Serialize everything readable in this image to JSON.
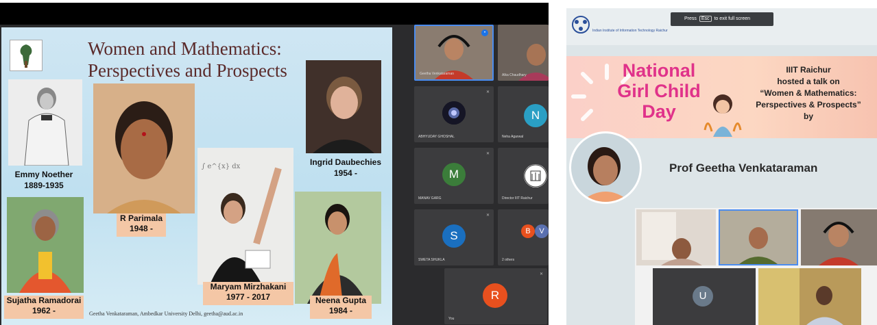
{
  "colors": {
    "slide_title": "#5a2a2a",
    "caption_bg": "#f4c7a6",
    "meeting_bg": "#2b2b2d",
    "banner_title": "#e0328a",
    "banner_bg": "#fbd4c4",
    "avatar_green": "#3b7d3a",
    "avatar_blue": "#1a6fbf",
    "avatar_orange": "#e8501e",
    "avatar_cyan": "#2a9fc4"
  },
  "slide": {
    "title_line1": "Women and Mathematics:",
    "title_line2": "Perspectives and Prospects",
    "people": [
      {
        "name": "Emmy Noether",
        "years": "1889-1935"
      },
      {
        "name": "R Parimala",
        "years": "1948 -"
      },
      {
        "name": "Ingrid Daubechies",
        "years": "1954 -"
      },
      {
        "name": "Sujatha Ramadorai",
        "years": "1962 -"
      },
      {
        "name": "Maryam Mirzhakani",
        "years": "1977 - 2017"
      },
      {
        "name": "Neena Gupta",
        "years": "1984 -"
      }
    ],
    "footer": "Geetha Venkataraman, Ambedkar University Delhi, geetha@aud.ac.in"
  },
  "meeting": {
    "tiles": [
      {
        "name": "Geetha Venkataraman",
        "icon": "video-person"
      },
      {
        "name": "Alka Chaudhary",
        "icon": "video-person"
      },
      {
        "name": "ABHYUDAY GHOSHAL",
        "icon": "profile-image"
      },
      {
        "name": "Neha Agarwal",
        "initial": "N"
      },
      {
        "name": "MANAV GARG",
        "initial": "M"
      },
      {
        "name": "Director IIIT Raichur",
        "icon": "logo"
      },
      {
        "name": "SWETA SHUKLA",
        "initial": "S"
      },
      {
        "name": "2 others",
        "initials": [
          "B",
          "V"
        ]
      },
      {
        "name": "You",
        "initial": "R"
      }
    ]
  },
  "right": {
    "header_text": "Indian Institute of Information Technology Raichur",
    "esc_tip_press": "Press",
    "esc_tip_key": "Esc",
    "esc_tip_rest": "to exit full screen",
    "banner_line1": "National",
    "banner_line2": "Girl Child",
    "banner_line3": "Day",
    "talk_line1": "IIIT Raichur",
    "talk_line2": "hosted a talk on",
    "talk_line3": "“Women & Mathematics:",
    "talk_line4": "Perspectives & Prospects”",
    "talk_line5": "by",
    "speaker": "Prof Geetha Venkataraman",
    "gallery": [
      {
        "initial": ""
      },
      {
        "initial": ""
      },
      {
        "initial": ""
      },
      {
        "initial": "U"
      },
      {
        "initial": ""
      }
    ]
  }
}
